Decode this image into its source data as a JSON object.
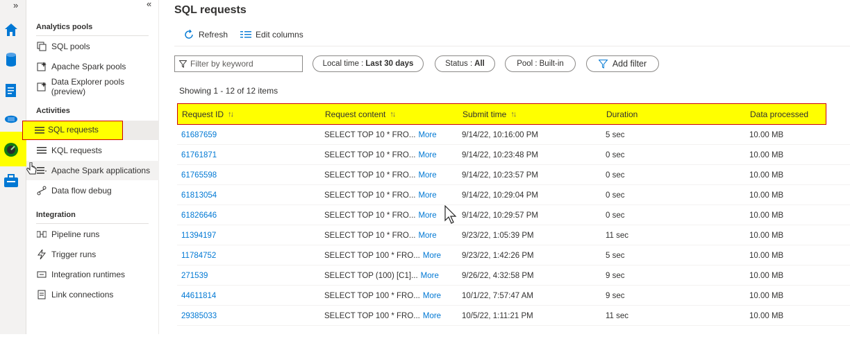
{
  "rail": {
    "expand_glyph": "»",
    "icons": [
      "home-icon",
      "database-icon",
      "document-icon",
      "pipeline-icon",
      "monitor-icon",
      "manage-icon"
    ],
    "highlight_color": "#ffff00"
  },
  "nav": {
    "collapse_glyph": "«",
    "sections": {
      "analytics": "Analytics pools",
      "activities": "Activities",
      "integration": "Integration"
    },
    "items": {
      "sql_pools": "SQL pools",
      "spark_pools": "Apache Spark pools",
      "data_explorer": "Data Explorer pools (preview)",
      "sql_requests": "SQL requests",
      "kql_requests": "KQL requests",
      "spark_apps": "Apache Spark applications",
      "data_flow": "Data flow debug",
      "pipeline_runs": "Pipeline runs",
      "trigger_runs": "Trigger runs",
      "integration_runtimes": "Integration runtimes",
      "link_connections": "Link connections"
    }
  },
  "main": {
    "title": "SQL requests",
    "toolbar": {
      "refresh": "Refresh",
      "edit_columns": "Edit columns"
    },
    "search_placeholder": "Filter by keyword",
    "filters": {
      "local_time_label": "Local time :",
      "local_time_value": "Last 30 days",
      "status_label": "Status :",
      "status_value": "All",
      "pool_label": "Pool :",
      "pool_value": "Built-in",
      "add_filter": "Add filter"
    },
    "showing": "Showing 1 - 12 of 12 items",
    "columns": {
      "request_id": "Request ID",
      "request_content": "Request content",
      "submit_time": "Submit time",
      "duration": "Duration",
      "data_processed": "Data processed"
    },
    "more_label": "More",
    "rows": [
      {
        "id": "61687659",
        "content": "SELECT TOP 10 * FRO...",
        "submit": "9/14/22, 10:16:00 PM",
        "duration": "5 sec",
        "data": "10.00 MB"
      },
      {
        "id": "61761871",
        "content": "SELECT TOP 10 * FRO...",
        "submit": "9/14/22, 10:23:48 PM",
        "duration": "0 sec",
        "data": "10.00 MB"
      },
      {
        "id": "61765598",
        "content": "SELECT TOP 10 * FRO...",
        "submit": "9/14/22, 10:23:57 PM",
        "duration": "0 sec",
        "data": "10.00 MB"
      },
      {
        "id": "61813054",
        "content": "SELECT TOP 10 * FRO...",
        "submit": "9/14/22, 10:29:04 PM",
        "duration": "0 sec",
        "data": "10.00 MB"
      },
      {
        "id": "61826646",
        "content": "SELECT TOP 10 * FRO...",
        "submit": "9/14/22, 10:29:57 PM",
        "duration": "0 sec",
        "data": "10.00 MB"
      },
      {
        "id": "11394197",
        "content": "SELECT TOP 10 * FRO...",
        "submit": "9/23/22, 1:05:39 PM",
        "duration": "11 sec",
        "data": "10.00 MB"
      },
      {
        "id": "11784752",
        "content": "SELECT TOP 100 * FRO...",
        "submit": "9/23/22, 1:42:26 PM",
        "duration": "5 sec",
        "data": "10.00 MB"
      },
      {
        "id": "271539",
        "content": "SELECT TOP (100) [C1]...",
        "submit": "9/26/22, 4:32:58 PM",
        "duration": "9 sec",
        "data": "10.00 MB"
      },
      {
        "id": "44611814",
        "content": "SELECT TOP 100 * FRO...",
        "submit": "10/1/22, 7:57:47 AM",
        "duration": "9 sec",
        "data": "10.00 MB"
      },
      {
        "id": "29385033",
        "content": "SELECT TOP 100 * FRO...",
        "submit": "10/5/22, 1:11:21 PM",
        "duration": "11 sec",
        "data": "10.00 MB"
      }
    ]
  },
  "colors": {
    "link": "#0078d4",
    "highlight": "#ffff00",
    "highlight_border": "#cc0000"
  }
}
